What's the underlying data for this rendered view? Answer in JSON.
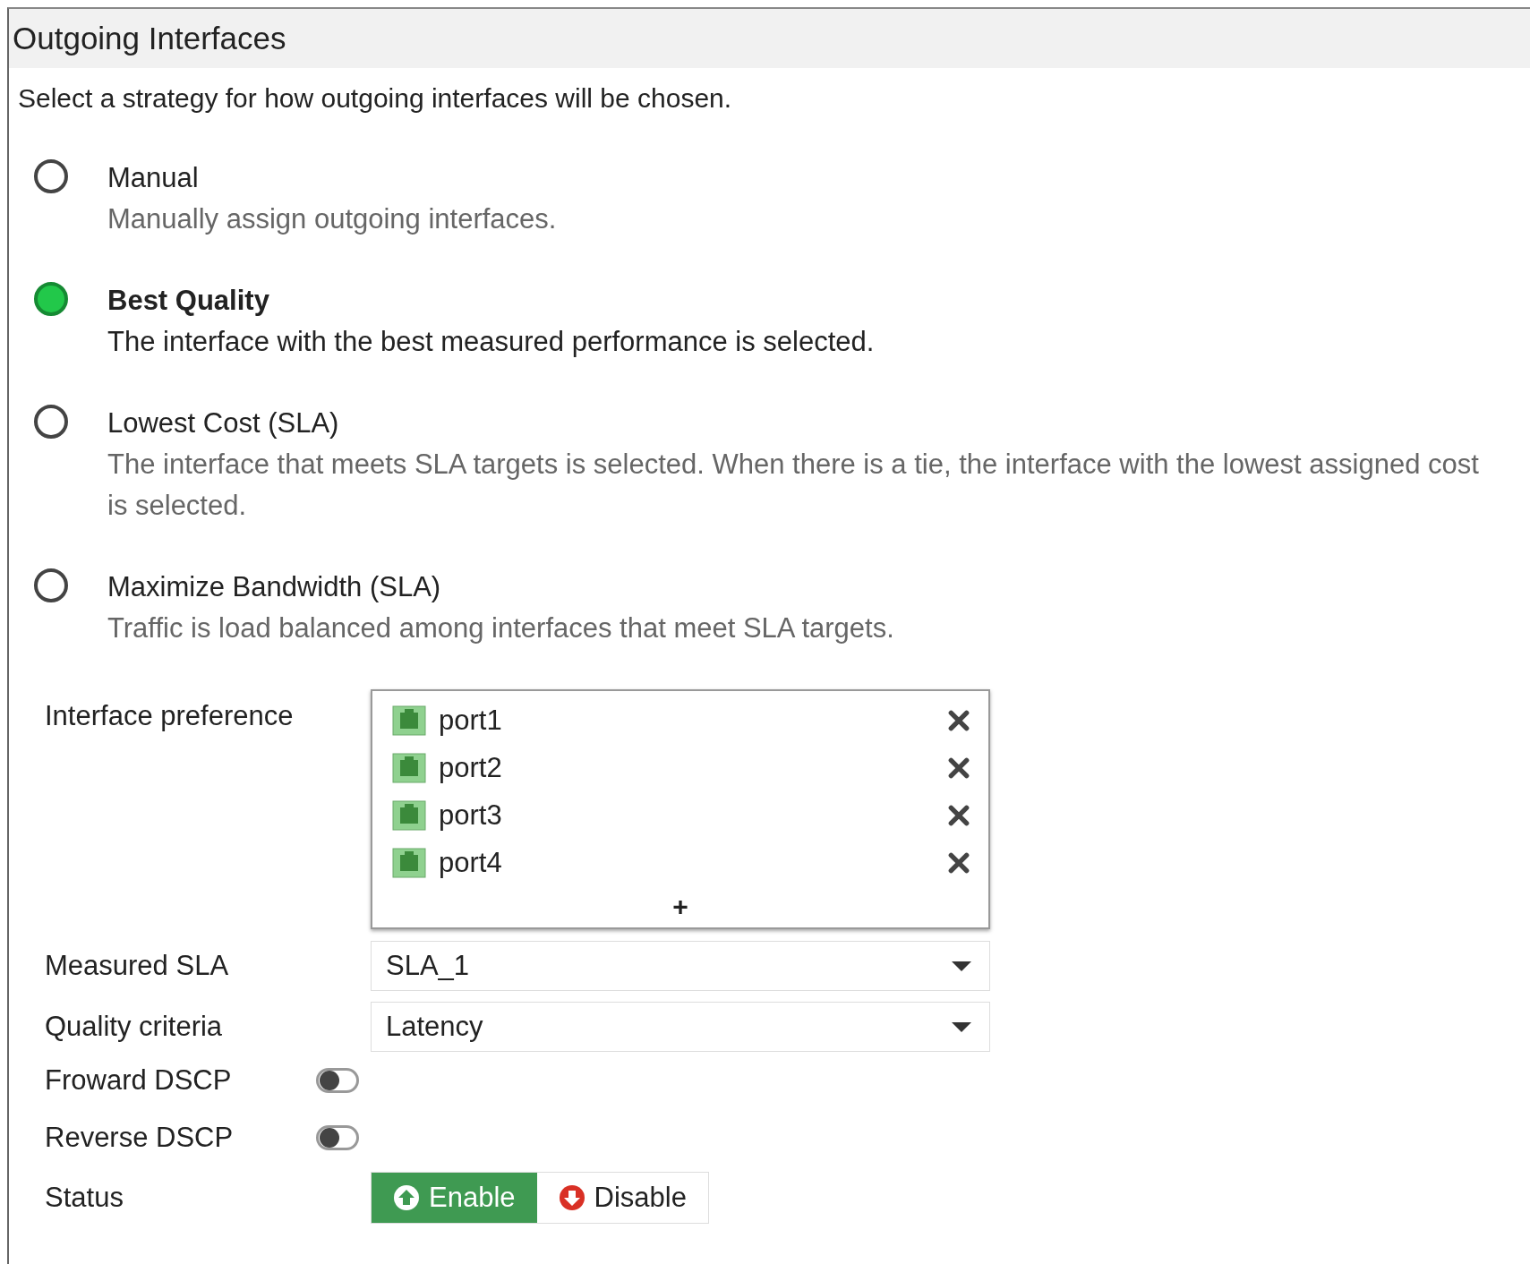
{
  "title": "Outgoing Interfaces",
  "description": "Select a strategy for how outgoing interfaces will be chosen.",
  "strategies": [
    {
      "label": "Manual",
      "description": "Manually assign outgoing interfaces.",
      "selected": false
    },
    {
      "label": "Best Quality",
      "description": "The interface with the best measured performance is selected.",
      "selected": true
    },
    {
      "label": "Lowest Cost (SLA)",
      "description": "The interface that meets SLA targets is selected. When there is a tie, the interface with the lowest assigned cost is selected.",
      "selected": false
    },
    {
      "label": "Maximize Bandwidth (SLA)",
      "description": "Traffic is load balanced among interfaces that meet SLA targets.",
      "selected": false
    }
  ],
  "interface_preference": {
    "label": "Interface preference",
    "items": [
      "port1",
      "port2",
      "port3",
      "port4"
    ],
    "add": "+"
  },
  "selects": [
    {
      "label": "Measured SLA",
      "value": "SLA_1"
    },
    {
      "label": "Quality criteria",
      "value": "Latency"
    }
  ],
  "toggles": [
    {
      "label": "Froward DSCP",
      "on": false
    },
    {
      "label": "Reverse DSCP",
      "on": false
    }
  ],
  "status": {
    "label": "Status",
    "options": [
      {
        "label": "Enable",
        "kind": "enable",
        "selected": true
      },
      {
        "label": "Disable",
        "kind": "disable",
        "selected": false
      }
    ]
  }
}
